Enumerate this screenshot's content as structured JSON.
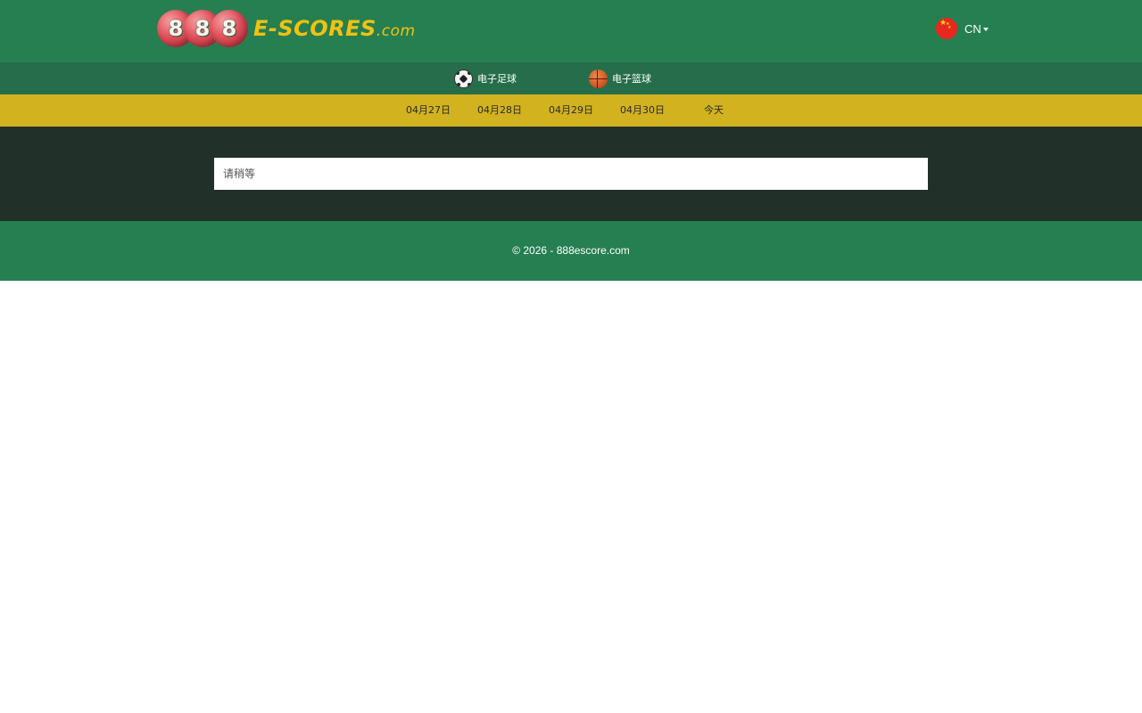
{
  "header": {
    "logo_digits": [
      "8",
      "8",
      "8"
    ],
    "logo_main": "E-SCORES",
    "logo_tld": ".com",
    "language": "CN"
  },
  "sports": [
    {
      "label": "电子足球",
      "icon": "soccer-ball-icon"
    },
    {
      "label": "电子篮球",
      "icon": "basketball-icon"
    }
  ],
  "dates": [
    "04月27日",
    "04月28日",
    "04月29日",
    "04月30日",
    "今天"
  ],
  "main": {
    "status_text": "请稍等"
  },
  "footer": {
    "copyright": "© 2026 - 888escore.com"
  },
  "colors": {
    "header_green": "#267f51",
    "sportbar_green": "#266e4b",
    "datebar_gold": "#d2b21f",
    "content_dark": "#22302a",
    "logo_yellow": "#f2c20f"
  }
}
